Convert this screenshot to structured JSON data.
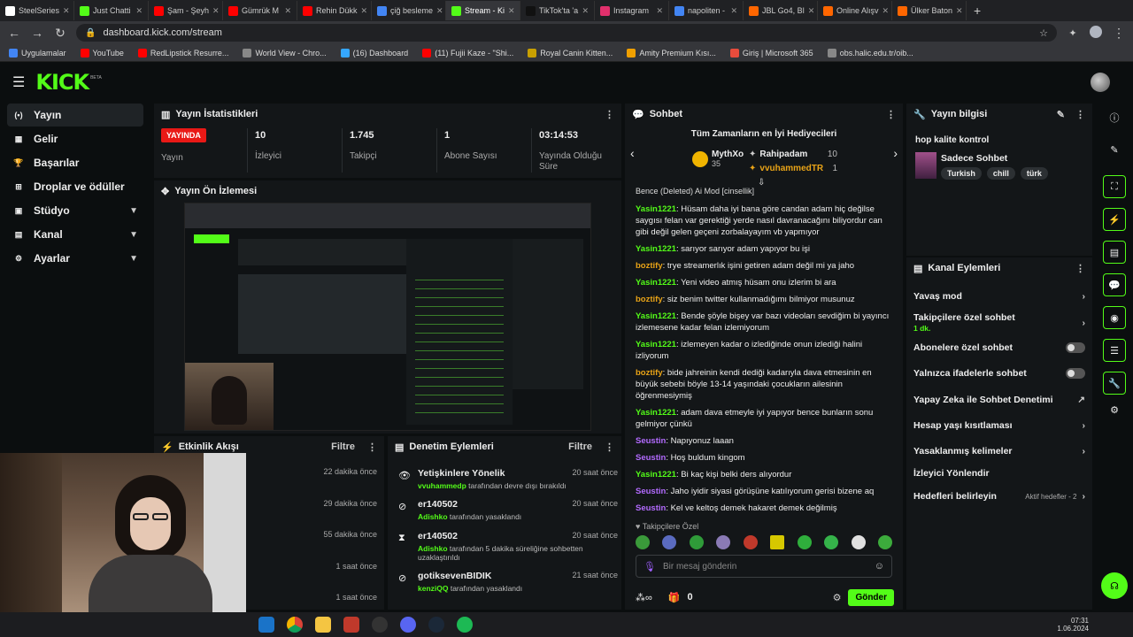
{
  "browser": {
    "tabs": [
      {
        "label": "SteelSeries",
        "color": "#ffffff"
      },
      {
        "label": "Just Chatti",
        "color": "#53fc18"
      },
      {
        "label": "Şam - Şeyh",
        "color": "#ff0000"
      },
      {
        "label": "Gümrük M",
        "color": "#ff0000"
      },
      {
        "label": "Rehin Dükk",
        "color": "#ff0000"
      },
      {
        "label": "çiğ besleme",
        "color": "#4285f4"
      },
      {
        "label": "Stream - Ki",
        "color": "#53fc18"
      },
      {
        "label": "TikTok'ta 'a",
        "color": "#111111"
      },
      {
        "label": "Instagram",
        "color": "#e1306c"
      },
      {
        "label": "napoliten -",
        "color": "#4285f4"
      },
      {
        "label": "JBL Go4, Bl",
        "color": "#ff6600"
      },
      {
        "label": "Online Alışv",
        "color": "#ff6600"
      },
      {
        "label": "Ülker Baton",
        "color": "#ff6600"
      }
    ],
    "url": "dashboard.kick.com/stream",
    "bookmarks": [
      {
        "label": "Uygulamalar",
        "color": "#4285f4"
      },
      {
        "label": "YouTube",
        "color": "#ff0000"
      },
      {
        "label": "RedLipstick Resurre...",
        "color": "#ff0000"
      },
      {
        "label": "World View - Chro...",
        "color": "#888888"
      },
      {
        "label": "(16) Dashboard",
        "color": "#35a7ff"
      },
      {
        "label": "(11) Fujii Kaze - \"Shi...",
        "color": "#ff0000"
      },
      {
        "label": "Royal Canin Kitten...",
        "color": "#c8a000"
      },
      {
        "label": "Amity Premium Kısı...",
        "color": "#f0a000"
      },
      {
        "label": "Giriş | Microsoft 365",
        "color": "#e74c3c"
      },
      {
        "label": "obs.halic.edu.tr/oib...",
        "color": "#888888"
      }
    ]
  },
  "kick": {
    "logo": "KICK",
    "beta": "BETA"
  },
  "sidebar": {
    "items": [
      {
        "label": "Yayın",
        "icon": "broadcast-icon",
        "glyph": "(•)",
        "chev": ""
      },
      {
        "label": "Gelir",
        "icon": "revenue-icon",
        "glyph": "▦",
        "chev": ""
      },
      {
        "label": "Başarılar",
        "icon": "trophy-icon",
        "glyph": "🏆",
        "chev": ""
      },
      {
        "label": "Droplar ve ödüller",
        "icon": "gift-icon",
        "glyph": "⊞",
        "chev": ""
      },
      {
        "label": "Stüdyo",
        "icon": "studio-icon",
        "glyph": "▣",
        "chev": "▼"
      },
      {
        "label": "Kanal",
        "icon": "channel-icon",
        "glyph": "▤",
        "chev": "▼"
      },
      {
        "label": "Ayarlar",
        "icon": "settings-icon",
        "glyph": "⚙",
        "chev": "▼"
      }
    ]
  },
  "stats": {
    "title": "Yayın İstatistikleri",
    "live": "YAYINDA",
    "live_label": "Yayın",
    "viewers": "10",
    "viewers_label": "İzleyici",
    "followers": "1.745",
    "followers_label": "Takipçi",
    "subs": "1",
    "subs_label": "Abone Sayısı",
    "duration": "03:14:53",
    "duration_label": "Yayında Olduğu Süre"
  },
  "preview": {
    "title": "Yayın Ön İzlemesi"
  },
  "activity": {
    "title": "Etkinlik Akışı",
    "filter": "Filtre",
    "times": [
      "22 dakika önce",
      "29 dakika önce",
      "55 dakika önce",
      "1 saat önce",
      "1 saat önce"
    ]
  },
  "mod": {
    "title": "Denetim Eylemleri",
    "filter": "Filtre",
    "rows": [
      {
        "user": "Yetişkinlere Yönelik",
        "who": "vvuhammedp",
        "action": " tarafından devre dışı bırakıldı",
        "time": "20 saat önce",
        "icon": "eye-icon",
        "glyph": "👁"
      },
      {
        "user": "er140502",
        "who": "Adishko",
        "action": " tarafından yasaklandı",
        "time": "20 saat önce",
        "icon": "ban-icon",
        "glyph": "⊘"
      },
      {
        "user": "er140502",
        "who": "Adishko",
        "action": " tarafından 5 dakika süreliğine sohbetten uzaklaştırıldı",
        "time": "20 saat önce",
        "icon": "hourglass-icon",
        "glyph": "⧗"
      },
      {
        "user": "gotiksevenBIDIK",
        "who": "kenziQQ",
        "action": " tarafından yasaklandı",
        "time": "21 saat önce",
        "icon": "ban-icon",
        "glyph": "⊘"
      }
    ]
  },
  "chat": {
    "title": "Sohbet",
    "gifters_title": "Tüm Zamanların en İyi Hediyecileri",
    "gifters": [
      {
        "name": "MythXo",
        "count": "35"
      },
      {
        "name": "Rahipadam",
        "count": "10"
      },
      {
        "name": "vvuhammedTR",
        "count": "1"
      }
    ],
    "partial": "Bence (Deleted) Ai Mod [cinsellik]",
    "partial_tag": "AI Mod",
    "messages": [
      {
        "user": "Yasin1221",
        "color": "#53fc18",
        "text": "Hüsam daha iyi bana göre candan adam hiç değilse saygısı felan var gerektiği yerde nasıl davranacağını biliyordur can gibi değil gelen geçeni zorbalayayım vb yapmıyor"
      },
      {
        "user": "Yasin1221",
        "color": "#53fc18",
        "text": "sarıyor sarıyor adam yapıyor bu işi"
      },
      {
        "user": "boztify",
        "color": "#e8a317",
        "text": "trye streamerlık işini getiren adam değil mi ya jaho"
      },
      {
        "user": "Yasin1221",
        "color": "#53fc18",
        "text": "Yeni video atmış hüsam onu izlerim bi ara"
      },
      {
        "user": "boztify",
        "color": "#e8a317",
        "text": "siz benim twitter kullanmadığımı bilmiyor musunuz"
      },
      {
        "user": "Yasin1221",
        "color": "#53fc18",
        "text": "Bende şöyle bişey var bazı videoları sevdiğim bi yayıncı izlemesene kadar felan izlemiyorum"
      },
      {
        "user": "Yasin1221",
        "color": "#53fc18",
        "text": "izlemeyen kadar o izlediğinde onun izlediği halini izliyorum"
      },
      {
        "user": "boztify",
        "color": "#e8a317",
        "text": "bide jahreinin kendi dediği kadarıyla dava etmesinin en büyük sebebi böyle 13-14 yaşındaki çocukların ailesinin öğrenmesiymiş"
      },
      {
        "user": "Yasin1221",
        "color": "#53fc18",
        "text": "adam dava etmeyle iyi yapıyor bence bunların sonu gelmiyor çünkü"
      },
      {
        "user": "Seustin",
        "color": "#b36bff",
        "text": "Napıyonuz laaan"
      },
      {
        "user": "Seustin",
        "color": "#b36bff",
        "text": "Hoş buldum kingom"
      },
      {
        "user": "Yasin1221",
        "color": "#53fc18",
        "text": "Bi kaç kişi belki ders alıyordur"
      },
      {
        "user": "Seustin",
        "color": "#b36bff",
        "text": "Jaho iyidir siyasi görüşüne katılıyorum gerisi bizene aq"
      },
      {
        "user": "Seustin",
        "color": "#b36bff",
        "text": "Kel ve keltoş demek hakaret demek değilmiş"
      }
    ],
    "followers_only": "Takipçilere Özel",
    "placeholder": "Bir mesaj gönderin",
    "points": "0",
    "send": "Gönder"
  },
  "info": {
    "title": "Yayın bilgisi",
    "stream_title": "hop kalite kontrol",
    "category": "Sadece Sohbet",
    "tags": [
      "Turkish",
      "chill",
      "türk"
    ]
  },
  "channel": {
    "title": "Kanal Eylemleri",
    "rows": [
      {
        "label": "Yavaş mod",
        "ctrl": "›",
        "sub": ""
      },
      {
        "label": "Takipçilere özel sohbet",
        "ctrl": "›",
        "sub": "1 dk."
      },
      {
        "label": "Abonelere özel sohbet",
        "ctrl": "toggle",
        "sub": ""
      },
      {
        "label": "Yalnızca ifadelerle sohbet",
        "ctrl": "toggle",
        "sub": ""
      },
      {
        "label": "Yapay Zeka ile Sohbet Denetimi",
        "ctrl": "↗",
        "sub": ""
      },
      {
        "label": "Hesap yaşı kısıtlaması",
        "ctrl": "›",
        "sub": ""
      },
      {
        "label": "Yasaklanmış kelimeler",
        "ctrl": "›",
        "sub": ""
      },
      {
        "label": "İzleyici Yönlendir",
        "ctrl": "",
        "sub": ""
      },
      {
        "label": "Hedefleri belirleyin",
        "ctrl": "›",
        "sub": "Aktif hedefler - 2"
      }
    ]
  },
  "taskbar": {
    "time": "07:31",
    "date": "1.06.2024"
  }
}
